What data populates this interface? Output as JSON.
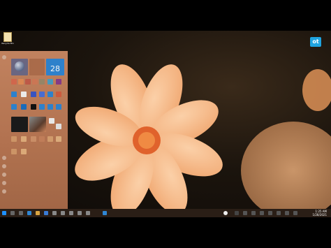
{
  "desktop": {
    "icon_label": "Recycle Bin"
  },
  "brand": {
    "logo_text": "ot"
  },
  "start_menu": {
    "calendar_day_number": "28"
  },
  "taskbar": {
    "time": "1:25 AM",
    "date": "1/28/2021"
  },
  "colors": {
    "start_menu_bg": "#c07e5a",
    "calendar_tile": "#2f86d3",
    "brand_logo": "#1fa3df",
    "flower_petal": "#f6b888",
    "flower_center": "#e0622c"
  }
}
